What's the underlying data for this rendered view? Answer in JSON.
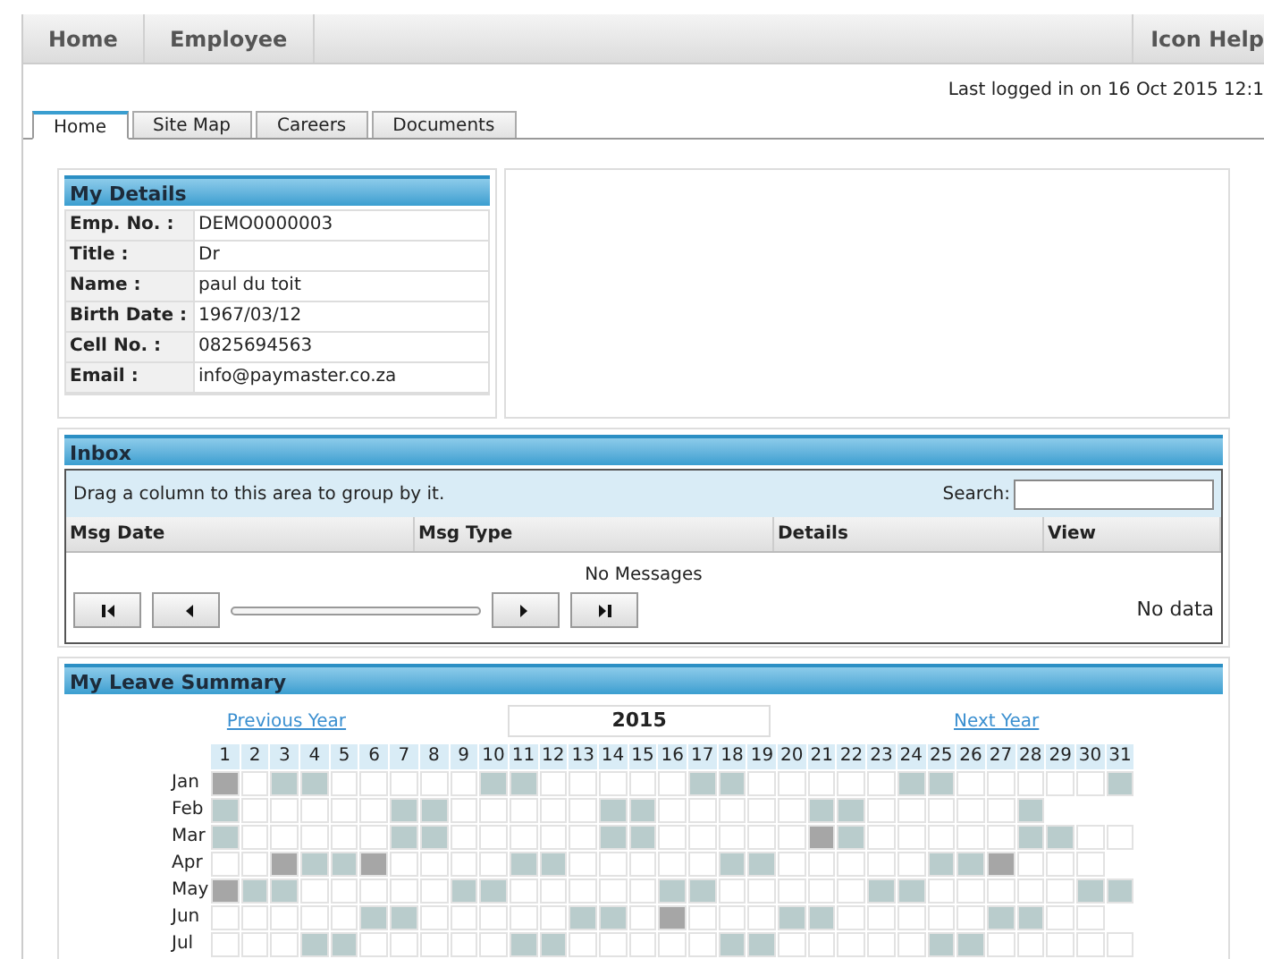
{
  "top_menu": {
    "items": [
      "Home",
      "Employee"
    ],
    "right_item": "Icon Help"
  },
  "last_login": "Last logged in on 16 Oct 2015 12:1",
  "tabs": [
    {
      "label": "Home",
      "selected": true
    },
    {
      "label": "Site Map",
      "selected": false
    },
    {
      "label": "Careers",
      "selected": false
    },
    {
      "label": "Documents",
      "selected": false
    }
  ],
  "my_details": {
    "title": "My Details",
    "rows": [
      {
        "label": "Emp. No. :",
        "value": "DEMO0000003"
      },
      {
        "label": "Title :",
        "value": "Dr"
      },
      {
        "label": "Name :",
        "value": "paul du toit"
      },
      {
        "label": "Birth Date :",
        "value": "1967/03/12"
      },
      {
        "label": "Cell No. :",
        "value": "0825694563"
      },
      {
        "label": "Email :",
        "value": "info@paymaster.co.za"
      }
    ]
  },
  "inbox": {
    "title": "Inbox",
    "group_hint": "Drag a column to this area to group by it.",
    "search_label": "Search:",
    "columns": [
      "Msg Date",
      "Msg Type",
      "Details",
      "View"
    ],
    "empty_text": "No Messages",
    "pager_slider": {
      "level": 0
    },
    "pager_status": "No data"
  },
  "leave_summary": {
    "title": "My Leave Summary",
    "previous": "Previous Year",
    "year": "2015",
    "next": "Next Year",
    "days": [
      "1",
      "2",
      "3",
      "4",
      "5",
      "6",
      "7",
      "8",
      "9",
      "10",
      "11",
      "12",
      "13",
      "14",
      "15",
      "16",
      "17",
      "18",
      "19",
      "20",
      "21",
      "22",
      "23",
      "24",
      "25",
      "26",
      "27",
      "28",
      "29",
      "30",
      "31"
    ],
    "months": [
      {
        "name": "Jan",
        "cells": [
          {
            "kind": "holiday"
          },
          {
            "kind": "none"
          },
          {
            "kind": "weekend"
          },
          {
            "kind": "weekend"
          },
          {
            "kind": "none"
          },
          {
            "kind": "none"
          },
          {
            "kind": "none"
          },
          {
            "kind": "none"
          },
          {
            "kind": "none"
          },
          {
            "kind": "weekend"
          },
          {
            "kind": "weekend"
          },
          {
            "kind": "none"
          },
          {
            "kind": "none"
          },
          {
            "kind": "none"
          },
          {
            "kind": "none"
          },
          {
            "kind": "none"
          },
          {
            "kind": "weekend"
          },
          {
            "kind": "weekend"
          },
          {
            "kind": "none"
          },
          {
            "kind": "none"
          },
          {
            "kind": "none"
          },
          {
            "kind": "none"
          },
          {
            "kind": "none"
          },
          {
            "kind": "weekend"
          },
          {
            "kind": "weekend"
          },
          {
            "kind": "none"
          },
          {
            "kind": "none"
          },
          {
            "kind": "none"
          },
          {
            "kind": "none"
          },
          {
            "kind": "none"
          },
          {
            "kind": "weekend"
          }
        ]
      },
      {
        "name": "Feb",
        "cells": [
          {
            "kind": "weekend"
          },
          {
            "kind": "none"
          },
          {
            "kind": "none"
          },
          {
            "kind": "none"
          },
          {
            "kind": "none"
          },
          {
            "kind": "none"
          },
          {
            "kind": "weekend"
          },
          {
            "kind": "weekend"
          },
          {
            "kind": "none"
          },
          {
            "kind": "none"
          },
          {
            "kind": "none"
          },
          {
            "kind": "none"
          },
          {
            "kind": "none"
          },
          {
            "kind": "weekend"
          },
          {
            "kind": "weekend"
          },
          {
            "kind": "none"
          },
          {
            "kind": "none"
          },
          {
            "kind": "none"
          },
          {
            "kind": "none"
          },
          {
            "kind": "none"
          },
          {
            "kind": "weekend"
          },
          {
            "kind": "weekend"
          },
          {
            "kind": "none"
          },
          {
            "kind": "none"
          },
          {
            "kind": "none"
          },
          {
            "kind": "none"
          },
          {
            "kind": "none"
          },
          {
            "kind": "weekend"
          }
        ]
      },
      {
        "name": "Mar",
        "cells": [
          {
            "kind": "weekend"
          },
          {
            "kind": "none"
          },
          {
            "kind": "none"
          },
          {
            "kind": "none"
          },
          {
            "kind": "none"
          },
          {
            "kind": "none"
          },
          {
            "kind": "weekend"
          },
          {
            "kind": "weekend"
          },
          {
            "kind": "none"
          },
          {
            "kind": "none"
          },
          {
            "kind": "none"
          },
          {
            "kind": "none"
          },
          {
            "kind": "none"
          },
          {
            "kind": "weekend"
          },
          {
            "kind": "weekend"
          },
          {
            "kind": "none"
          },
          {
            "kind": "none"
          },
          {
            "kind": "none"
          },
          {
            "kind": "none"
          },
          {
            "kind": "none"
          },
          {
            "kind": "holiday"
          },
          {
            "kind": "weekend"
          },
          {
            "kind": "none"
          },
          {
            "kind": "none"
          },
          {
            "kind": "none"
          },
          {
            "kind": "none"
          },
          {
            "kind": "none"
          },
          {
            "kind": "weekend"
          },
          {
            "kind": "weekend"
          },
          {
            "kind": "none"
          },
          {
            "kind": "none"
          }
        ]
      },
      {
        "name": "Apr",
        "cells": [
          {
            "kind": "none"
          },
          {
            "kind": "none"
          },
          {
            "kind": "holiday"
          },
          {
            "kind": "weekend"
          },
          {
            "kind": "weekend"
          },
          {
            "kind": "holiday"
          },
          {
            "kind": "none"
          },
          {
            "kind": "none"
          },
          {
            "kind": "none"
          },
          {
            "kind": "none"
          },
          {
            "kind": "weekend"
          },
          {
            "kind": "weekend"
          },
          {
            "kind": "none"
          },
          {
            "kind": "none"
          },
          {
            "kind": "none"
          },
          {
            "kind": "none"
          },
          {
            "kind": "none"
          },
          {
            "kind": "weekend"
          },
          {
            "kind": "weekend"
          },
          {
            "kind": "none"
          },
          {
            "kind": "none"
          },
          {
            "kind": "none"
          },
          {
            "kind": "none"
          },
          {
            "kind": "none"
          },
          {
            "kind": "weekend"
          },
          {
            "kind": "weekend"
          },
          {
            "kind": "holiday"
          },
          {
            "kind": "none"
          },
          {
            "kind": "none"
          },
          {
            "kind": "none"
          }
        ]
      },
      {
        "name": "May",
        "cells": [
          {
            "kind": "holiday"
          },
          {
            "kind": "weekend"
          },
          {
            "kind": "weekend"
          },
          {
            "kind": "none"
          },
          {
            "kind": "none"
          },
          {
            "kind": "none"
          },
          {
            "kind": "none"
          },
          {
            "kind": "none"
          },
          {
            "kind": "weekend"
          },
          {
            "kind": "weekend"
          },
          {
            "kind": "none"
          },
          {
            "kind": "none"
          },
          {
            "kind": "none"
          },
          {
            "kind": "none"
          },
          {
            "kind": "none"
          },
          {
            "kind": "weekend"
          },
          {
            "kind": "weekend"
          },
          {
            "kind": "none"
          },
          {
            "kind": "none"
          },
          {
            "kind": "none"
          },
          {
            "kind": "none"
          },
          {
            "kind": "none"
          },
          {
            "kind": "weekend"
          },
          {
            "kind": "weekend"
          },
          {
            "kind": "none"
          },
          {
            "kind": "none"
          },
          {
            "kind": "none"
          },
          {
            "kind": "none"
          },
          {
            "kind": "none"
          },
          {
            "kind": "weekend"
          },
          {
            "kind": "weekend"
          }
        ]
      },
      {
        "name": "Jun",
        "cells": [
          {
            "kind": "none"
          },
          {
            "kind": "none"
          },
          {
            "kind": "none"
          },
          {
            "kind": "none"
          },
          {
            "kind": "none"
          },
          {
            "kind": "weekend"
          },
          {
            "kind": "weekend"
          },
          {
            "kind": "none"
          },
          {
            "kind": "none"
          },
          {
            "kind": "none"
          },
          {
            "kind": "none"
          },
          {
            "kind": "none"
          },
          {
            "kind": "weekend"
          },
          {
            "kind": "weekend"
          },
          {
            "kind": "none"
          },
          {
            "kind": "holiday"
          },
          {
            "kind": "none"
          },
          {
            "kind": "none"
          },
          {
            "kind": "none"
          },
          {
            "kind": "weekend"
          },
          {
            "kind": "weekend"
          },
          {
            "kind": "none"
          },
          {
            "kind": "none"
          },
          {
            "kind": "none"
          },
          {
            "kind": "none"
          },
          {
            "kind": "none"
          },
          {
            "kind": "weekend"
          },
          {
            "kind": "weekend"
          },
          {
            "kind": "none"
          },
          {
            "kind": "none"
          }
        ]
      },
      {
        "name": "Jul",
        "cells": [
          {
            "kind": "none"
          },
          {
            "kind": "none"
          },
          {
            "kind": "none"
          },
          {
            "kind": "weekend"
          },
          {
            "kind": "weekend"
          },
          {
            "kind": "none"
          },
          {
            "kind": "none"
          },
          {
            "kind": "none"
          },
          {
            "kind": "none"
          },
          {
            "kind": "none"
          },
          {
            "kind": "weekend"
          },
          {
            "kind": "weekend"
          },
          {
            "kind": "none"
          },
          {
            "kind": "none"
          },
          {
            "kind": "none"
          },
          {
            "kind": "none"
          },
          {
            "kind": "none"
          },
          {
            "kind": "weekend"
          },
          {
            "kind": "weekend"
          },
          {
            "kind": "none"
          },
          {
            "kind": "none"
          },
          {
            "kind": "none"
          },
          {
            "kind": "none"
          },
          {
            "kind": "none"
          },
          {
            "kind": "weekend"
          },
          {
            "kind": "weekend"
          },
          {
            "kind": "none"
          },
          {
            "kind": "none"
          },
          {
            "kind": "none"
          },
          {
            "kind": "none"
          },
          {
            "kind": "none"
          }
        ]
      }
    ]
  }
}
